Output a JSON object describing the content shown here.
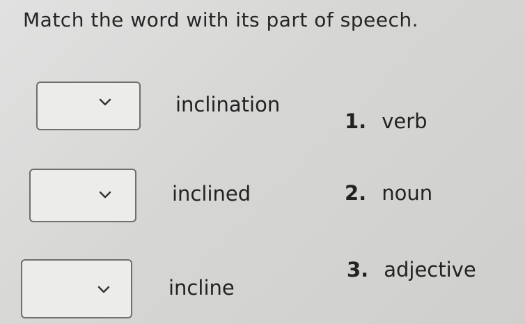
{
  "title": "Match the word with its part of speech.",
  "rows": [
    {
      "word": "inclination",
      "dropdown_value": ""
    },
    {
      "word": "inclined",
      "dropdown_value": ""
    },
    {
      "word": "incline",
      "dropdown_value": ""
    }
  ],
  "options": [
    {
      "number": "1.",
      "label": "verb"
    },
    {
      "number": "2.",
      "label": "noun"
    },
    {
      "number": "3.",
      "label": "adjective"
    }
  ],
  "icons": {
    "dropdown_arrow": "chevron-down-icon"
  }
}
